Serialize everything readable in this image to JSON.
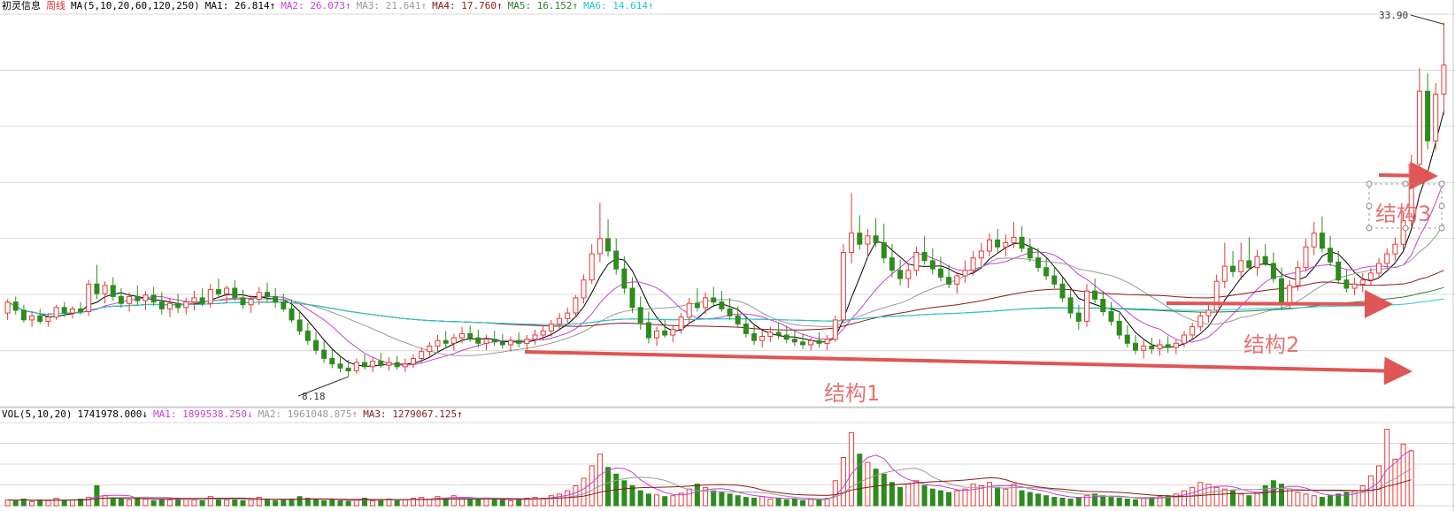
{
  "header": {
    "stock_name": "初灵信息",
    "period": "周线",
    "ma_config": "MA(5,10,20,60,120,250)",
    "ma_items": [
      {
        "label": "MA1:",
        "value": "26.814↑",
        "color": "#000000"
      },
      {
        "label": "MA2:",
        "value": "26.073↑",
        "color": "#c83fd4"
      },
      {
        "label": "MA3:",
        "value": "21.641↑",
        "color": "#999999"
      },
      {
        "label": "MA4:",
        "value": "17.760↑",
        "color": "#8b1a1a"
      },
      {
        "label": "MA5:",
        "value": "16.152↑",
        "color": "#2e7d32"
      },
      {
        "label": "MA6:",
        "value": "14.614↑",
        "color": "#26c6da"
      }
    ]
  },
  "volume_header": {
    "config": "VOL(5,10,20)",
    "vol_value": "1741978.000↓",
    "items": [
      {
        "label": "MA1:",
        "value": "1899538.250↓",
        "color": "#c83fd4"
      },
      {
        "label": "MA2:",
        "value": "1961048.875↑",
        "color": "#999999"
      },
      {
        "label": "MA3:",
        "value": "1279067.125↑",
        "color": "#8b1a1a"
      }
    ]
  },
  "annotations": {
    "high_label": "33.90",
    "low_label": "8.18",
    "structure_1": "结构1",
    "structure_2": "结构2",
    "structure_3": "结构3"
  },
  "chart_data": {
    "type": "candlestick",
    "period": "weekly",
    "ylim": [
      6.0,
      34.5
    ],
    "high_price": 33.9,
    "low_price": 8.18,
    "bars": [
      [
        12.8,
        13.8,
        12.3,
        13.6
      ],
      [
        13.6,
        14.0,
        12.7,
        13.0
      ],
      [
        13.0,
        13.4,
        12.1,
        12.3
      ],
      [
        12.3,
        12.9,
        11.8,
        12.6
      ],
      [
        12.6,
        13.1,
        12.0,
        12.2
      ],
      [
        12.2,
        12.8,
        11.8,
        12.5
      ],
      [
        12.5,
        13.4,
        12.3,
        13.2
      ],
      [
        13.2,
        13.6,
        12.5,
        12.8
      ],
      [
        12.8,
        13.3,
        12.4,
        13.1
      ],
      [
        13.1,
        13.6,
        12.7,
        12.9
      ],
      [
        12.9,
        15.2,
        12.6,
        14.9
      ],
      [
        14.9,
        16.3,
        13.8,
        14.2
      ],
      [
        14.2,
        15.1,
        13.5,
        14.8
      ],
      [
        14.8,
        15.4,
        13.7,
        14.0
      ],
      [
        14.0,
        14.6,
        13.2,
        13.5
      ],
      [
        13.5,
        14.3,
        12.9,
        14.0
      ],
      [
        14.0,
        14.8,
        13.4,
        13.7
      ],
      [
        13.7,
        14.4,
        13.0,
        14.1
      ],
      [
        14.1,
        14.7,
        13.3,
        13.6
      ],
      [
        13.6,
        14.3,
        12.7,
        13.1
      ],
      [
        13.1,
        13.9,
        12.5,
        13.5
      ],
      [
        13.5,
        14.2,
        12.8,
        13.2
      ],
      [
        13.2,
        13.9,
        12.7,
        13.6
      ],
      [
        13.6,
        14.4,
        13.0,
        13.9
      ],
      [
        13.9,
        14.6,
        13.3,
        13.5
      ],
      [
        13.5,
        14.9,
        13.2,
        14.5
      ],
      [
        14.5,
        15.3,
        13.9,
        14.2
      ],
      [
        14.2,
        14.8,
        13.5,
        14.6
      ],
      [
        14.6,
        15.2,
        13.7,
        13.9
      ],
      [
        13.9,
        14.5,
        13.1,
        13.4
      ],
      [
        13.4,
        14.1,
        12.8,
        13.8
      ],
      [
        13.8,
        14.7,
        13.4,
        14.3
      ],
      [
        14.3,
        15.0,
        13.6,
        14.0
      ],
      [
        14.0,
        14.6,
        13.2,
        13.6
      ],
      [
        13.6,
        14.2,
        12.9,
        13.1
      ],
      [
        13.1,
        13.8,
        12.1,
        12.3
      ],
      [
        12.3,
        12.9,
        11.2,
        11.5
      ],
      [
        11.5,
        12.1,
        10.5,
        10.8
      ],
      [
        10.8,
        11.4,
        9.8,
        10.1
      ],
      [
        10.1,
        10.8,
        9.2,
        9.5
      ],
      [
        9.5,
        10.2,
        8.8,
        9.1
      ],
      [
        9.1,
        9.7,
        8.5,
        8.8
      ],
      [
        8.8,
        9.4,
        8.18,
        8.6
      ],
      [
        8.6,
        9.5,
        8.4,
        9.2
      ],
      [
        9.2,
        9.8,
        8.7,
        8.9
      ],
      [
        8.9,
        9.6,
        8.5,
        9.3
      ],
      [
        9.3,
        9.9,
        8.8,
        9.0
      ],
      [
        9.0,
        9.6,
        8.6,
        9.2
      ],
      [
        9.2,
        9.7,
        8.7,
        8.9
      ],
      [
        8.9,
        9.5,
        8.5,
        9.1
      ],
      [
        9.1,
        9.8,
        8.8,
        9.5
      ],
      [
        9.5,
        10.3,
        9.2,
        10.0
      ],
      [
        10.0,
        10.7,
        9.6,
        10.4
      ],
      [
        10.4,
        11.2,
        10.0,
        10.8
      ],
      [
        10.8,
        11.5,
        10.2,
        10.6
      ],
      [
        10.6,
        11.3,
        10.1,
        11.0
      ],
      [
        11.0,
        11.8,
        10.6,
        11.3
      ],
      [
        11.3,
        11.9,
        10.7,
        11.0
      ],
      [
        11.0,
        11.6,
        10.3,
        10.6
      ],
      [
        10.6,
        11.2,
        10.1,
        10.9
      ],
      [
        10.9,
        11.5,
        10.4,
        10.7
      ],
      [
        10.7,
        11.3,
        10.2,
        10.5
      ],
      [
        10.5,
        11.1,
        10.0,
        10.8
      ],
      [
        10.8,
        11.4,
        10.3,
        10.6
      ],
      [
        10.6,
        11.2,
        10.1,
        10.9
      ],
      [
        10.9,
        11.6,
        10.5,
        11.2
      ],
      [
        11.2,
        11.9,
        10.8,
        11.5
      ],
      [
        11.5,
        12.3,
        11.1,
        12.0
      ],
      [
        12.0,
        12.8,
        11.6,
        12.4
      ],
      [
        12.4,
        13.2,
        12.0,
        12.8
      ],
      [
        12.8,
        14.1,
        12.5,
        13.9
      ],
      [
        13.9,
        15.6,
        13.5,
        15.2
      ],
      [
        15.2,
        17.8,
        14.9,
        17.1
      ],
      [
        17.1,
        20.8,
        16.5,
        18.2
      ],
      [
        18.2,
        19.6,
        16.9,
        17.3
      ],
      [
        17.3,
        18.2,
        15.6,
        16.0
      ],
      [
        16.0,
        16.9,
        14.2,
        14.6
      ],
      [
        14.6,
        15.4,
        12.8,
        13.2
      ],
      [
        13.2,
        14.0,
        11.6,
        12.1
      ],
      [
        12.1,
        12.9,
        10.6,
        11.0
      ],
      [
        11.0,
        11.8,
        10.4,
        11.5
      ],
      [
        11.5,
        12.3,
        11.0,
        11.2
      ],
      [
        11.2,
        11.9,
        10.7,
        11.6
      ],
      [
        11.6,
        12.8,
        11.3,
        12.5
      ],
      [
        12.5,
        13.9,
        12.1,
        13.5
      ],
      [
        13.5,
        14.6,
        12.9,
        13.2
      ],
      [
        13.2,
        14.3,
        12.7,
        13.9
      ],
      [
        13.9,
        14.7,
        13.2,
        13.6
      ],
      [
        13.6,
        14.4,
        12.9,
        13.1
      ],
      [
        13.1,
        13.9,
        12.3,
        12.6
      ],
      [
        12.6,
        13.3,
        11.8,
        12.0
      ],
      [
        12.0,
        12.6,
        11.0,
        11.3
      ],
      [
        11.3,
        11.9,
        10.5,
        10.8
      ],
      [
        10.8,
        11.5,
        10.3,
        11.1
      ],
      [
        11.1,
        11.8,
        10.7,
        11.4
      ],
      [
        11.4,
        12.1,
        10.9,
        11.2
      ],
      [
        11.2,
        11.9,
        10.6,
        10.9
      ],
      [
        10.9,
        11.6,
        10.4,
        10.7
      ],
      [
        10.7,
        11.3,
        10.2,
        10.5
      ],
      [
        10.5,
        11.0,
        10.1,
        10.8
      ],
      [
        10.8,
        11.4,
        10.3,
        10.6
      ],
      [
        10.6,
        11.2,
        10.1,
        10.9
      ],
      [
        10.9,
        12.6,
        10.7,
        12.3
      ],
      [
        12.3,
        17.8,
        12.1,
        17.2
      ],
      [
        17.2,
        21.5,
        16.4,
        18.6
      ],
      [
        18.6,
        19.9,
        17.4,
        17.8
      ],
      [
        17.8,
        18.9,
        16.8,
        18.4
      ],
      [
        18.4,
        19.7,
        17.6,
        17.9
      ],
      [
        17.9,
        19.3,
        16.4,
        16.8
      ],
      [
        16.8,
        17.8,
        15.4,
        15.9
      ],
      [
        15.9,
        16.7,
        14.8,
        15.3
      ],
      [
        15.3,
        16.4,
        14.6,
        15.9
      ],
      [
        15.9,
        17.6,
        15.5,
        17.2
      ],
      [
        17.2,
        18.4,
        16.3,
        16.6
      ],
      [
        16.6,
        17.5,
        15.6,
        16.0
      ],
      [
        16.0,
        16.9,
        15.1,
        15.4
      ],
      [
        15.4,
        16.3,
        14.6,
        14.9
      ],
      [
        14.9,
        15.8,
        14.2,
        15.5
      ],
      [
        15.5,
        16.6,
        15.0,
        15.9
      ],
      [
        15.9,
        17.3,
        15.5,
        16.8
      ],
      [
        16.8,
        17.9,
        16.2,
        17.3
      ],
      [
        17.3,
        18.6,
        16.9,
        18.1
      ],
      [
        18.1,
        18.9,
        17.2,
        17.6
      ],
      [
        17.6,
        18.5,
        16.9,
        17.9
      ],
      [
        17.9,
        19.4,
        17.5,
        18.3
      ],
      [
        18.3,
        19.1,
        17.2,
        17.5
      ],
      [
        17.5,
        18.2,
        16.5,
        16.8
      ],
      [
        16.8,
        17.5,
        15.8,
        16.1
      ],
      [
        16.1,
        16.8,
        15.2,
        15.5
      ],
      [
        15.5,
        16.2,
        14.6,
        14.9
      ],
      [
        14.9,
        15.5,
        13.6,
        13.9
      ],
      [
        13.9,
        14.6,
        12.4,
        12.8
      ],
      [
        12.8,
        13.4,
        11.6,
        12.2
      ],
      [
        12.2,
        14.9,
        11.8,
        14.4
      ],
      [
        14.4,
        15.3,
        13.5,
        13.8
      ],
      [
        13.8,
        14.4,
        12.6,
        12.9
      ],
      [
        12.9,
        13.6,
        11.9,
        12.2
      ],
      [
        12.2,
        12.8,
        10.9,
        11.2
      ],
      [
        11.2,
        11.9,
        10.3,
        10.6
      ],
      [
        10.6,
        11.2,
        9.8,
        10.1
      ],
      [
        10.1,
        10.8,
        9.5,
        10.4
      ],
      [
        10.4,
        11.0,
        9.8,
        10.2
      ],
      [
        10.2,
        10.9,
        9.7,
        10.5
      ],
      [
        10.5,
        11.1,
        9.9,
        10.3
      ],
      [
        10.3,
        10.9,
        9.8,
        10.6
      ],
      [
        10.6,
        11.5,
        10.3,
        11.2
      ],
      [
        11.2,
        12.1,
        10.9,
        11.8
      ],
      [
        11.8,
        12.9,
        11.5,
        12.6
      ],
      [
        12.6,
        13.5,
        12.1,
        13.0
      ],
      [
        13.0,
        15.6,
        12.8,
        15.1
      ],
      [
        15.1,
        17.9,
        14.6,
        16.2
      ],
      [
        16.2,
        17.3,
        15.4,
        15.8
      ],
      [
        15.8,
        17.9,
        15.2,
        16.6
      ],
      [
        16.6,
        18.3,
        15.9,
        16.1
      ],
      [
        16.1,
        17.4,
        15.5,
        16.9
      ],
      [
        16.9,
        17.8,
        16.2,
        16.4
      ],
      [
        16.4,
        17.2,
        15.0,
        15.3
      ],
      [
        15.3,
        16.1,
        13.0,
        13.4
      ],
      [
        13.4,
        15.2,
        13.1,
        14.8
      ],
      [
        14.8,
        16.6,
        14.4,
        16.1
      ],
      [
        16.1,
        18.2,
        15.8,
        17.6
      ],
      [
        17.6,
        19.4,
        17.0,
        18.6
      ],
      [
        18.6,
        19.8,
        17.2,
        17.5
      ],
      [
        17.5,
        18.4,
        16.2,
        16.5
      ],
      [
        16.5,
        17.3,
        14.9,
        15.2
      ],
      [
        15.2,
        15.9,
        14.3,
        14.6
      ],
      [
        14.6,
        15.4,
        14.1,
        14.9
      ],
      [
        14.9,
        15.7,
        14.3,
        15.2
      ],
      [
        15.2,
        16.1,
        14.8,
        15.7
      ],
      [
        15.7,
        16.8,
        15.3,
        16.4
      ],
      [
        16.4,
        17.5,
        16.0,
        17.1
      ],
      [
        17.1,
        18.3,
        16.6,
        17.8
      ],
      [
        17.8,
        20.2,
        17.4,
        19.5
      ],
      [
        19.5,
        24.3,
        19.1,
        23.6
      ],
      [
        23.6,
        30.6,
        22.8,
        28.9
      ],
      [
        28.9,
        30.2,
        24.7,
        25.3
      ],
      [
        25.3,
        29.5,
        24.6,
        28.7
      ],
      [
        28.7,
        33.9,
        27.2,
        30.8
      ]
    ],
    "vol_ylim": [
      0,
      100
    ],
    "volume": [
      7,
      6,
      8,
      5,
      7,
      6,
      9,
      6,
      7,
      8,
      10,
      24,
      12,
      9,
      8,
      7,
      10,
      8,
      6,
      8,
      7,
      9,
      8,
      7,
      6,
      11,
      9,
      7,
      8,
      6,
      7,
      10,
      8,
      6,
      7,
      8,
      11,
      9,
      7,
      6,
      8,
      6,
      5,
      7,
      9,
      6,
      7,
      8,
      6,
      7,
      9,
      10,
      8,
      11,
      9,
      12,
      10,
      8,
      7,
      9,
      8,
      7,
      6,
      8,
      9,
      10,
      9,
      12,
      14,
      18,
      24,
      33,
      48,
      62,
      46,
      38,
      30,
      24,
      18,
      14,
      13,
      11,
      12,
      15,
      20,
      26,
      22,
      18,
      16,
      14,
      12,
      10,
      9,
      11,
      8,
      9,
      7,
      8,
      6,
      8,
      7,
      9,
      30,
      58,
      88,
      62,
      52,
      44,
      38,
      28,
      22,
      26,
      30,
      24,
      20,
      18,
      16,
      18,
      20,
      26,
      24,
      28,
      22,
      20,
      26,
      18,
      16,
      14,
      12,
      10,
      9,
      8,
      10,
      12,
      14,
      12,
      10,
      9,
      8,
      7,
      9,
      10,
      11,
      12,
      14,
      18,
      22,
      28,
      26,
      22,
      20,
      18,
      14,
      12,
      16,
      24,
      30,
      26,
      20,
      16,
      14,
      12,
      10,
      12,
      14,
      16,
      18,
      24,
      36,
      48,
      92,
      56,
      74,
      66
    ],
    "ma_colors": [
      "#000000",
      "#c83fd4",
      "#999999",
      "#8b1a1a",
      "#2e7d32",
      "#26c6da"
    ]
  }
}
